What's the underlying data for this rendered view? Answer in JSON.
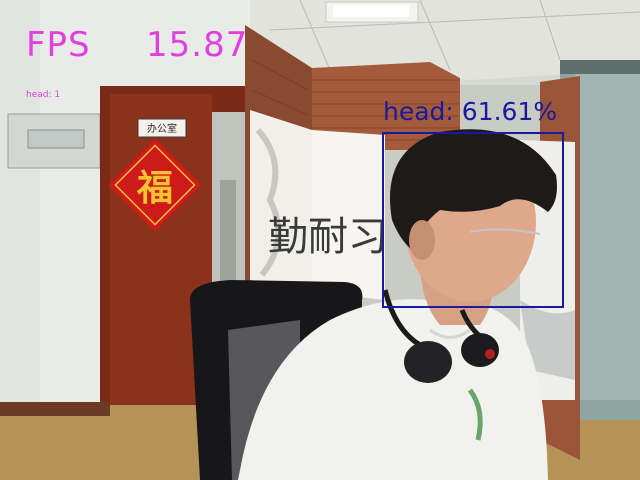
{
  "overlay": {
    "fps_label": "FPS",
    "fps_value": "15.87",
    "count_text": "head: 1",
    "detection_label": "head: 61.61%"
  },
  "detections": [
    {
      "class": "head",
      "confidence_percent": 61.61
    }
  ],
  "colors": {
    "fps_text": "#e040e0",
    "count_text": "#e040e0",
    "detection_box": "#1a1aa0",
    "detection_text": "#1a1aa0"
  },
  "scene": {
    "door_sign": "办公室",
    "fu_character": "福",
    "screen_calligraphy": "勤耐习"
  }
}
